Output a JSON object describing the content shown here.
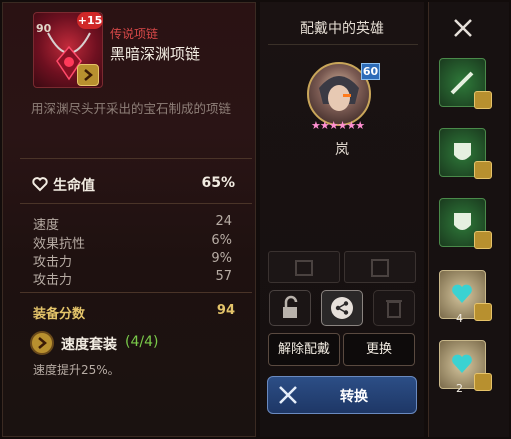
{
  "item": {
    "level": "90",
    "enhance": "+15",
    "rarity": "传说项链",
    "name": "黑暗深渊项链",
    "description": "用深渊尽头开采出的宝石制成的项链"
  },
  "main_stat": {
    "label": "生命值",
    "value": "65%"
  },
  "sub_stats": [
    {
      "label": "速度",
      "value": "24"
    },
    {
      "label": "效果抗性",
      "value": "6%"
    },
    {
      "label": "攻击力",
      "value": "9%"
    },
    {
      "label": "攻击力",
      "value": "57"
    }
  ],
  "score": {
    "label": "装备分数",
    "value": "94"
  },
  "set": {
    "name": "速度套装",
    "count": "(4/4)",
    "effect": "速度提升25%。"
  },
  "equipped_hero": {
    "title": "配戴中的英雄",
    "name": "岚",
    "level": "60",
    "stars": "★★★★★★"
  },
  "actions": {
    "unequip": "解除配戴",
    "replace": "更换",
    "convert": "转换"
  },
  "inventory": {
    "counts": [
      "4",
      "2"
    ]
  },
  "icons": [
    "heart-icon",
    "lock-open-icon",
    "share-icon",
    "trash-icon",
    "swords-icon",
    "speed-set-icon"
  ]
}
